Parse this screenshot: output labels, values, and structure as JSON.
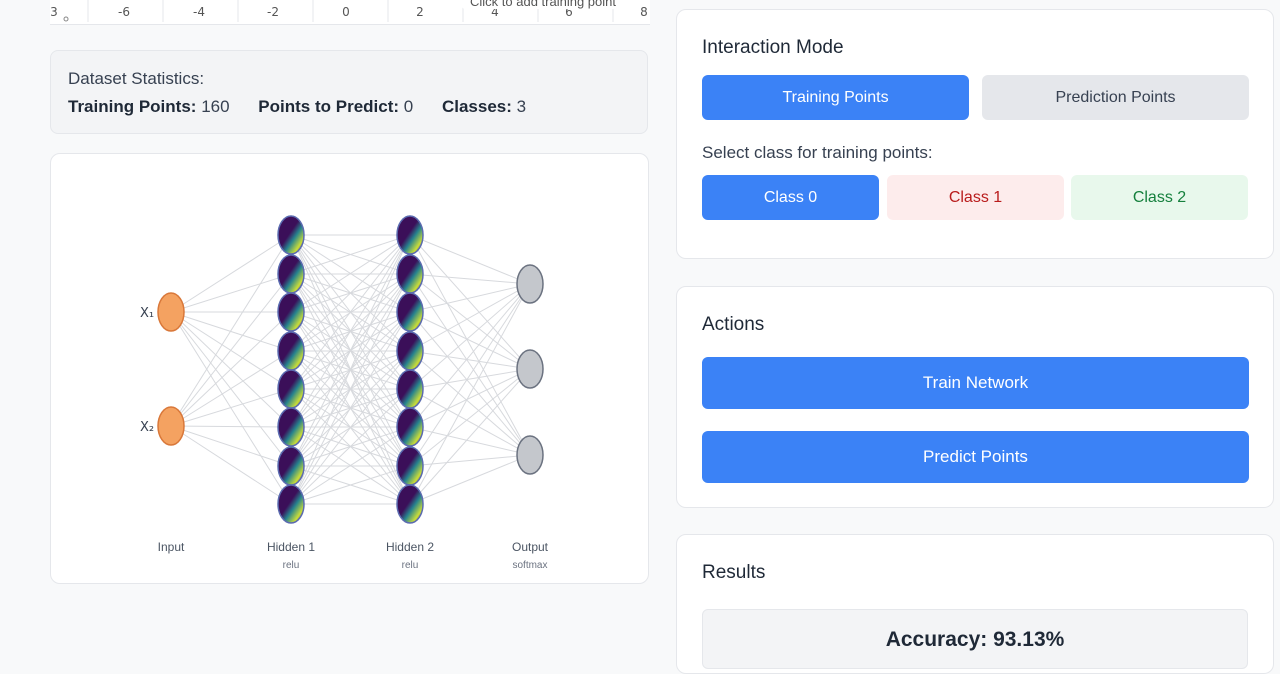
{
  "plot_strip": {
    "ticks": [
      "-6",
      "-4",
      "-2",
      "0",
      "2",
      "4",
      "6",
      "8"
    ],
    "edge_tick": "3",
    "hint": "Click to add training point"
  },
  "stats": {
    "title": "Dataset Statistics:",
    "training_label": "Training Points:",
    "training_value": "160",
    "predict_label": "Points to Predict:",
    "predict_value": "0",
    "classes_label": "Classes:",
    "classes_value": "3"
  },
  "network": {
    "inputs": [
      "X₁",
      "X₂"
    ],
    "layers": [
      {
        "name": "Input",
        "activation": ""
      },
      {
        "name": "Hidden 1",
        "activation": "relu"
      },
      {
        "name": "Hidden 2",
        "activation": "relu"
      },
      {
        "name": "Output",
        "activation": "softmax"
      }
    ],
    "colors": {
      "input": "#f4a261",
      "hidden_dark": "#3b0f59",
      "hidden_light": "#c9dd3a",
      "output": "#c4c7cc",
      "edge": "#d7d9dd"
    }
  },
  "interaction": {
    "title": "Interaction Mode",
    "mode_training": "Training Points",
    "mode_prediction": "Prediction Points",
    "class_prompt": "Select class for training points:",
    "classes": [
      "Class 0",
      "Class 1",
      "Class 2"
    ]
  },
  "actions": {
    "title": "Actions",
    "train": "Train Network",
    "predict": "Predict Points"
  },
  "results": {
    "title": "Results",
    "accuracy": "Accuracy: 93.13%"
  },
  "theme": {
    "primary": "#3b82f6"
  }
}
